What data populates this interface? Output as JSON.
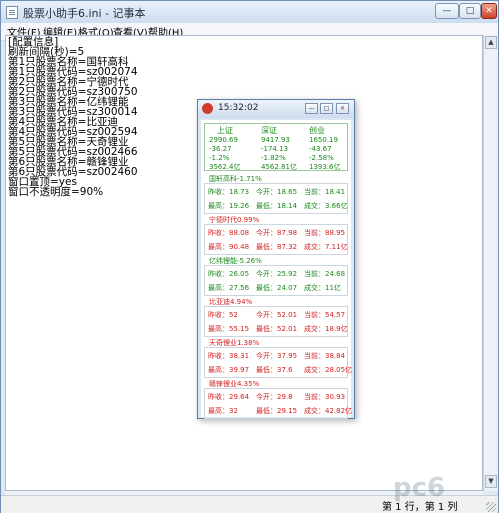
{
  "notepad": {
    "title": "股票小助手6.ini - 记事本",
    "menu": [
      "文件(F)",
      "编辑(E)",
      "格式(O)",
      "查看(V)",
      "帮助(H)"
    ],
    "lines": [
      "[配置信息]",
      "刷新间隔(秒)=5",
      "第1只股票名称=国轩高科",
      "第1只股票代码=sz002074",
      "第2只股票名称=宁德时代",
      "第2只股票代码=sz300750",
      "第3只股票名称=亿纬锂能",
      "第3只股票代码=sz300014",
      "第4只股票名称=比亚迪",
      "第4只股票代码=sz002594",
      "第5只股票名称=天奇锂业",
      "第5只股票代码=sz002466",
      "第6只股票名称=赣锋锂业",
      "第6只股票代码=sz002460",
      "窗口置顶=yes",
      "窗口不透明度=90%"
    ],
    "status": "第 1 行，第 1 列",
    "watermark": "pc6"
  },
  "widget": {
    "time": "15:32:02",
    "indices": [
      {
        "name": "上证",
        "values": [
          "2990.69",
          "-36.27",
          "-1.2%",
          "3562.4亿"
        ]
      },
      {
        "name": "深证",
        "values": [
          "9417.93",
          "-174.13",
          "-1.82%",
          "4562.81亿"
        ]
      },
      {
        "name": "创业",
        "values": [
          "1650.19",
          "-43.67",
          "-2.58%",
          "1393.6亿"
        ]
      }
    ],
    "stocks": [
      {
        "header": "国轩高科-1.71%",
        "color": "green",
        "prev": "昨收：18.73",
        "open": "今开：18.65",
        "cur": "当前：18.41",
        "high": "最高：19.26",
        "low": "最低：18.14",
        "vol": "成交：3.66亿"
      },
      {
        "header": "宁德时代0.99%",
        "color": "red",
        "prev": "昨收：88.08",
        "open": "今开：87.98",
        "cur": "当前：88.95",
        "high": "最高：90.48",
        "low": "最低：87.32",
        "vol": "成交：7.11亿"
      },
      {
        "header": "亿纬锂能-5.26%",
        "color": "green",
        "prev": "昨收：26.05",
        "open": "今开：25.92",
        "cur": "当前：24.68",
        "high": "最高：27.56",
        "low": "最低：24.07",
        "vol": "成交：11亿"
      },
      {
        "header": "比亚迪4.94%",
        "color": "red",
        "prev": "昨收：52",
        "open": "今开：52.01",
        "cur": "当前：54.57",
        "high": "最高：55.15",
        "low": "最低：52.01",
        "vol": "成交：18.9亿"
      },
      {
        "header": "天奇锂业1.38%",
        "color": "red",
        "prev": "昨收：38.31",
        "open": "今开：37.95",
        "cur": "当前：38.84",
        "high": "最高：39.97",
        "low": "最低：37.6",
        "vol": "成交：28.05亿"
      },
      {
        "header": "赣锋锂业4.35%",
        "color": "red",
        "prev": "昨收：29.64",
        "open": "今开：29.8",
        "cur": "当前：30.93",
        "high": "最高：32",
        "low": "最低：29.15",
        "vol": "成交：42.82亿"
      }
    ]
  }
}
